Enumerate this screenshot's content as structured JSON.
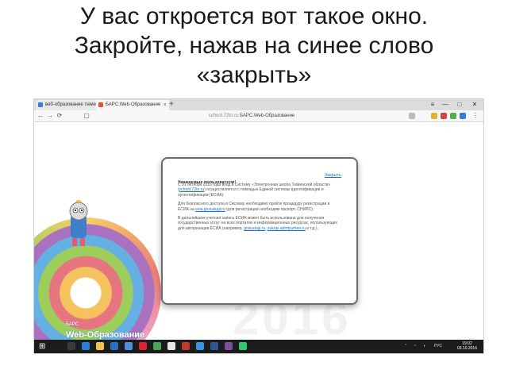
{
  "slide": {
    "title_line1": "У вас откроется вот такое окно.",
    "title_line2": "Закройте, нажав на синее слово",
    "title_line3": "«закрыть»"
  },
  "browser": {
    "tabs": [
      {
        "label": "веб-образование тюмень",
        "active": false,
        "icon_color": "#3a7bd5"
      },
      {
        "label": "БАРС.Web-Образование",
        "active": true,
        "icon_color": "#e5533c"
      }
    ],
    "new_tab": "+",
    "window_controls": [
      "≡",
      "—",
      "□",
      "✕"
    ],
    "url_host": "school.72to.ru",
    "url_title": "БАРС.Web-Образование"
  },
  "page": {
    "logo_small": "БАРС",
    "logo_text": "Web-Образование",
    "watermark": "2016"
  },
  "modal": {
    "title": "Уважаемые пользователи!",
    "close_label": "Закрыть",
    "para1_a": "С 01 октября 2016 года вход в Систему «Электронная школа Тюменской области» (",
    "para1_link": "school.72to.ru",
    "para1_b": ") осуществляется с помощью Единой системы идентификации и аутентификации (ЕСИА).",
    "para2_a": "Для безопасного доступа в Систему необходимо пройти процедуру регистрации в ЕСИА на ",
    "para2_link": "esia.gosuslugi.ru",
    "para2_b": " (для регистрации необходим паспорт, СНИЛС).",
    "para3_a": "В дальнейшем учетная запись ЕСИА может быть использована для получения государственных услуг на всех порталах и информационных ресурсах, использующих для авторизации ЕСИА (например, ",
    "para3_link1": "gosuslugi.ru",
    "para3_sep": ", ",
    "para3_link2": "zakupi.admtyumen.ru",
    "para3_b": " и т.д.)."
  },
  "taskbar": {
    "start": "⊞",
    "lang": "РУС",
    "time": "19:02",
    "date": "03.10.2016",
    "apps": [
      {
        "name": "search",
        "color": "#1c1c1c"
      },
      {
        "name": "task-view",
        "color": "#3a3a3a"
      },
      {
        "name": "edge",
        "color": "#2d7fd6"
      },
      {
        "name": "explorer",
        "color": "#f2c14e"
      },
      {
        "name": "store",
        "color": "#2a6fc0"
      },
      {
        "name": "mail",
        "color": "#4e8fe0"
      },
      {
        "name": "opera",
        "color": "#d7262e"
      },
      {
        "name": "chrome",
        "color": "#4aa657"
      },
      {
        "name": "yandex",
        "color": "#e8e8e8"
      },
      {
        "name": "app",
        "color": "#c0392b"
      },
      {
        "name": "app",
        "color": "#3498db"
      },
      {
        "name": "word",
        "color": "#2b5797"
      },
      {
        "name": "viber",
        "color": "#7b519d"
      },
      {
        "name": "app",
        "color": "#2ecc71"
      }
    ]
  }
}
